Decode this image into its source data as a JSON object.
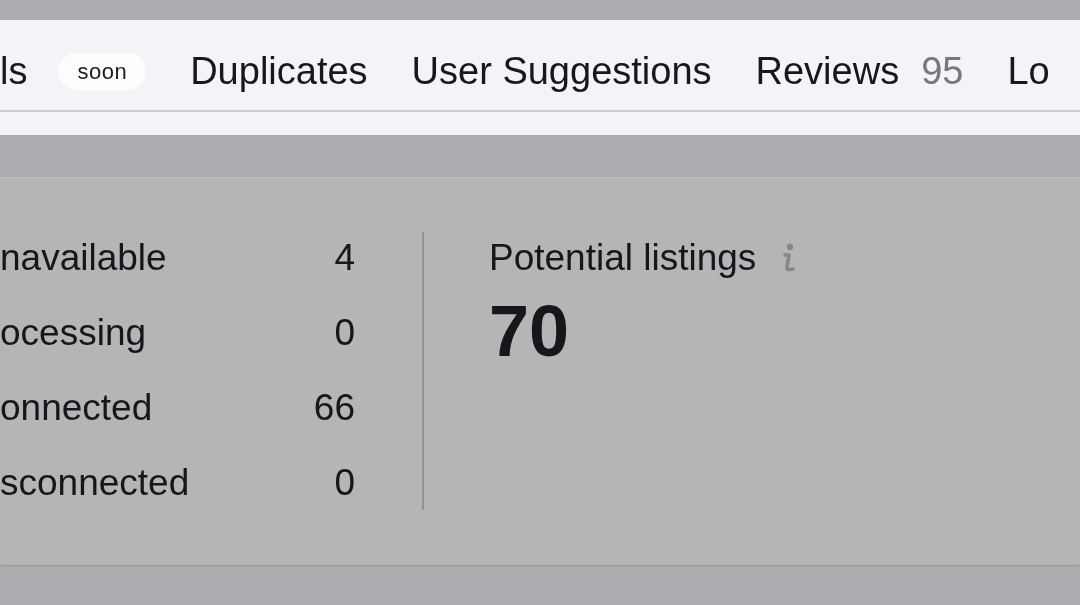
{
  "tabs": [
    {
      "label": "ls",
      "badge": "soon"
    },
    {
      "label": "Duplicates"
    },
    {
      "label": "User Suggestions"
    },
    {
      "label": "Reviews",
      "count": "95"
    },
    {
      "label": "Lo"
    }
  ],
  "stats": [
    {
      "label": "navailable",
      "value": "4"
    },
    {
      "label": "ocessing",
      "value": "0"
    },
    {
      "label": "onnected",
      "value": "66"
    },
    {
      "label": "sconnected",
      "value": "0"
    }
  ],
  "potential_listings": {
    "title": "Potential listings",
    "value": "70"
  }
}
